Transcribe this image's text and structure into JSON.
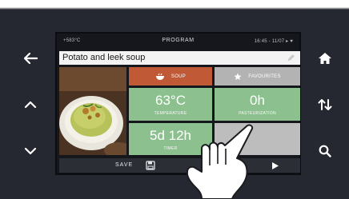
{
  "status": {
    "left": "+583°C",
    "title": "PROGRAM",
    "right": "16:45 - 11/07 ▸ ♥"
  },
  "recipe": {
    "title": "Potato and leek soup"
  },
  "tiles": {
    "category": "SOUP",
    "favourites": "FAVOURITES",
    "temperature": {
      "value": "63°C",
      "label": "TEMPERATURE"
    },
    "pasteurization": {
      "value": "0h",
      "label": "PASTEURIZATION"
    },
    "time": {
      "value": "5d 12h",
      "label": "TIMER"
    }
  },
  "bottom": {
    "save_label": "SAVE"
  },
  "icons": {
    "back": "arrow-left-icon",
    "up": "chevron-up-icon",
    "down": "chevron-down-icon",
    "home": "home-icon",
    "sort": "sort-arrows-icon",
    "search": "search-icon",
    "edit": "pencil-icon",
    "soup": "soup-bowl-icon",
    "favourite": "star-icon",
    "save": "floppy-disk-icon",
    "play": "play-icon",
    "hand": "pointing-hand-icon"
  },
  "colors": {
    "device": "#252830",
    "soup_tile": "#c05a36",
    "value_tile": "#8cc08f",
    "neutral_tile": "#b3b3b3"
  }
}
